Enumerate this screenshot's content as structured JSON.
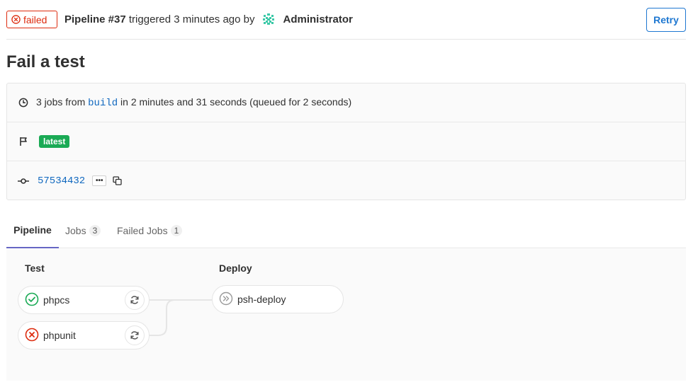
{
  "header": {
    "status": "failed",
    "pipeline_label": "Pipeline #37",
    "triggered_text": "triggered 3 minutes ago by",
    "user": "Administrator",
    "retry_label": "Retry"
  },
  "title": "Fail a test",
  "info": {
    "jobs_prefix": "3 jobs from",
    "branch": "build",
    "jobs_suffix": "in 2 minutes and 31 seconds (queued for 2 seconds)",
    "tag": "latest",
    "commit_sha": "57534432",
    "ellipsis": "•••"
  },
  "tabs": [
    {
      "label": "Pipeline"
    },
    {
      "label": "Jobs",
      "count": "3"
    },
    {
      "label": "Failed Jobs",
      "count": "1"
    }
  ],
  "stages": [
    {
      "title": "Test",
      "jobs": [
        {
          "name": "phpcs",
          "status": "success"
        },
        {
          "name": "phpunit",
          "status": "failed"
        }
      ]
    },
    {
      "title": "Deploy",
      "jobs": [
        {
          "name": "psh-deploy",
          "status": "skipped"
        }
      ]
    }
  ],
  "colors": {
    "failed": "#dd2b0e",
    "success": "#1aaa55",
    "link": "#1068bf",
    "tab_active": "#6666c4"
  }
}
